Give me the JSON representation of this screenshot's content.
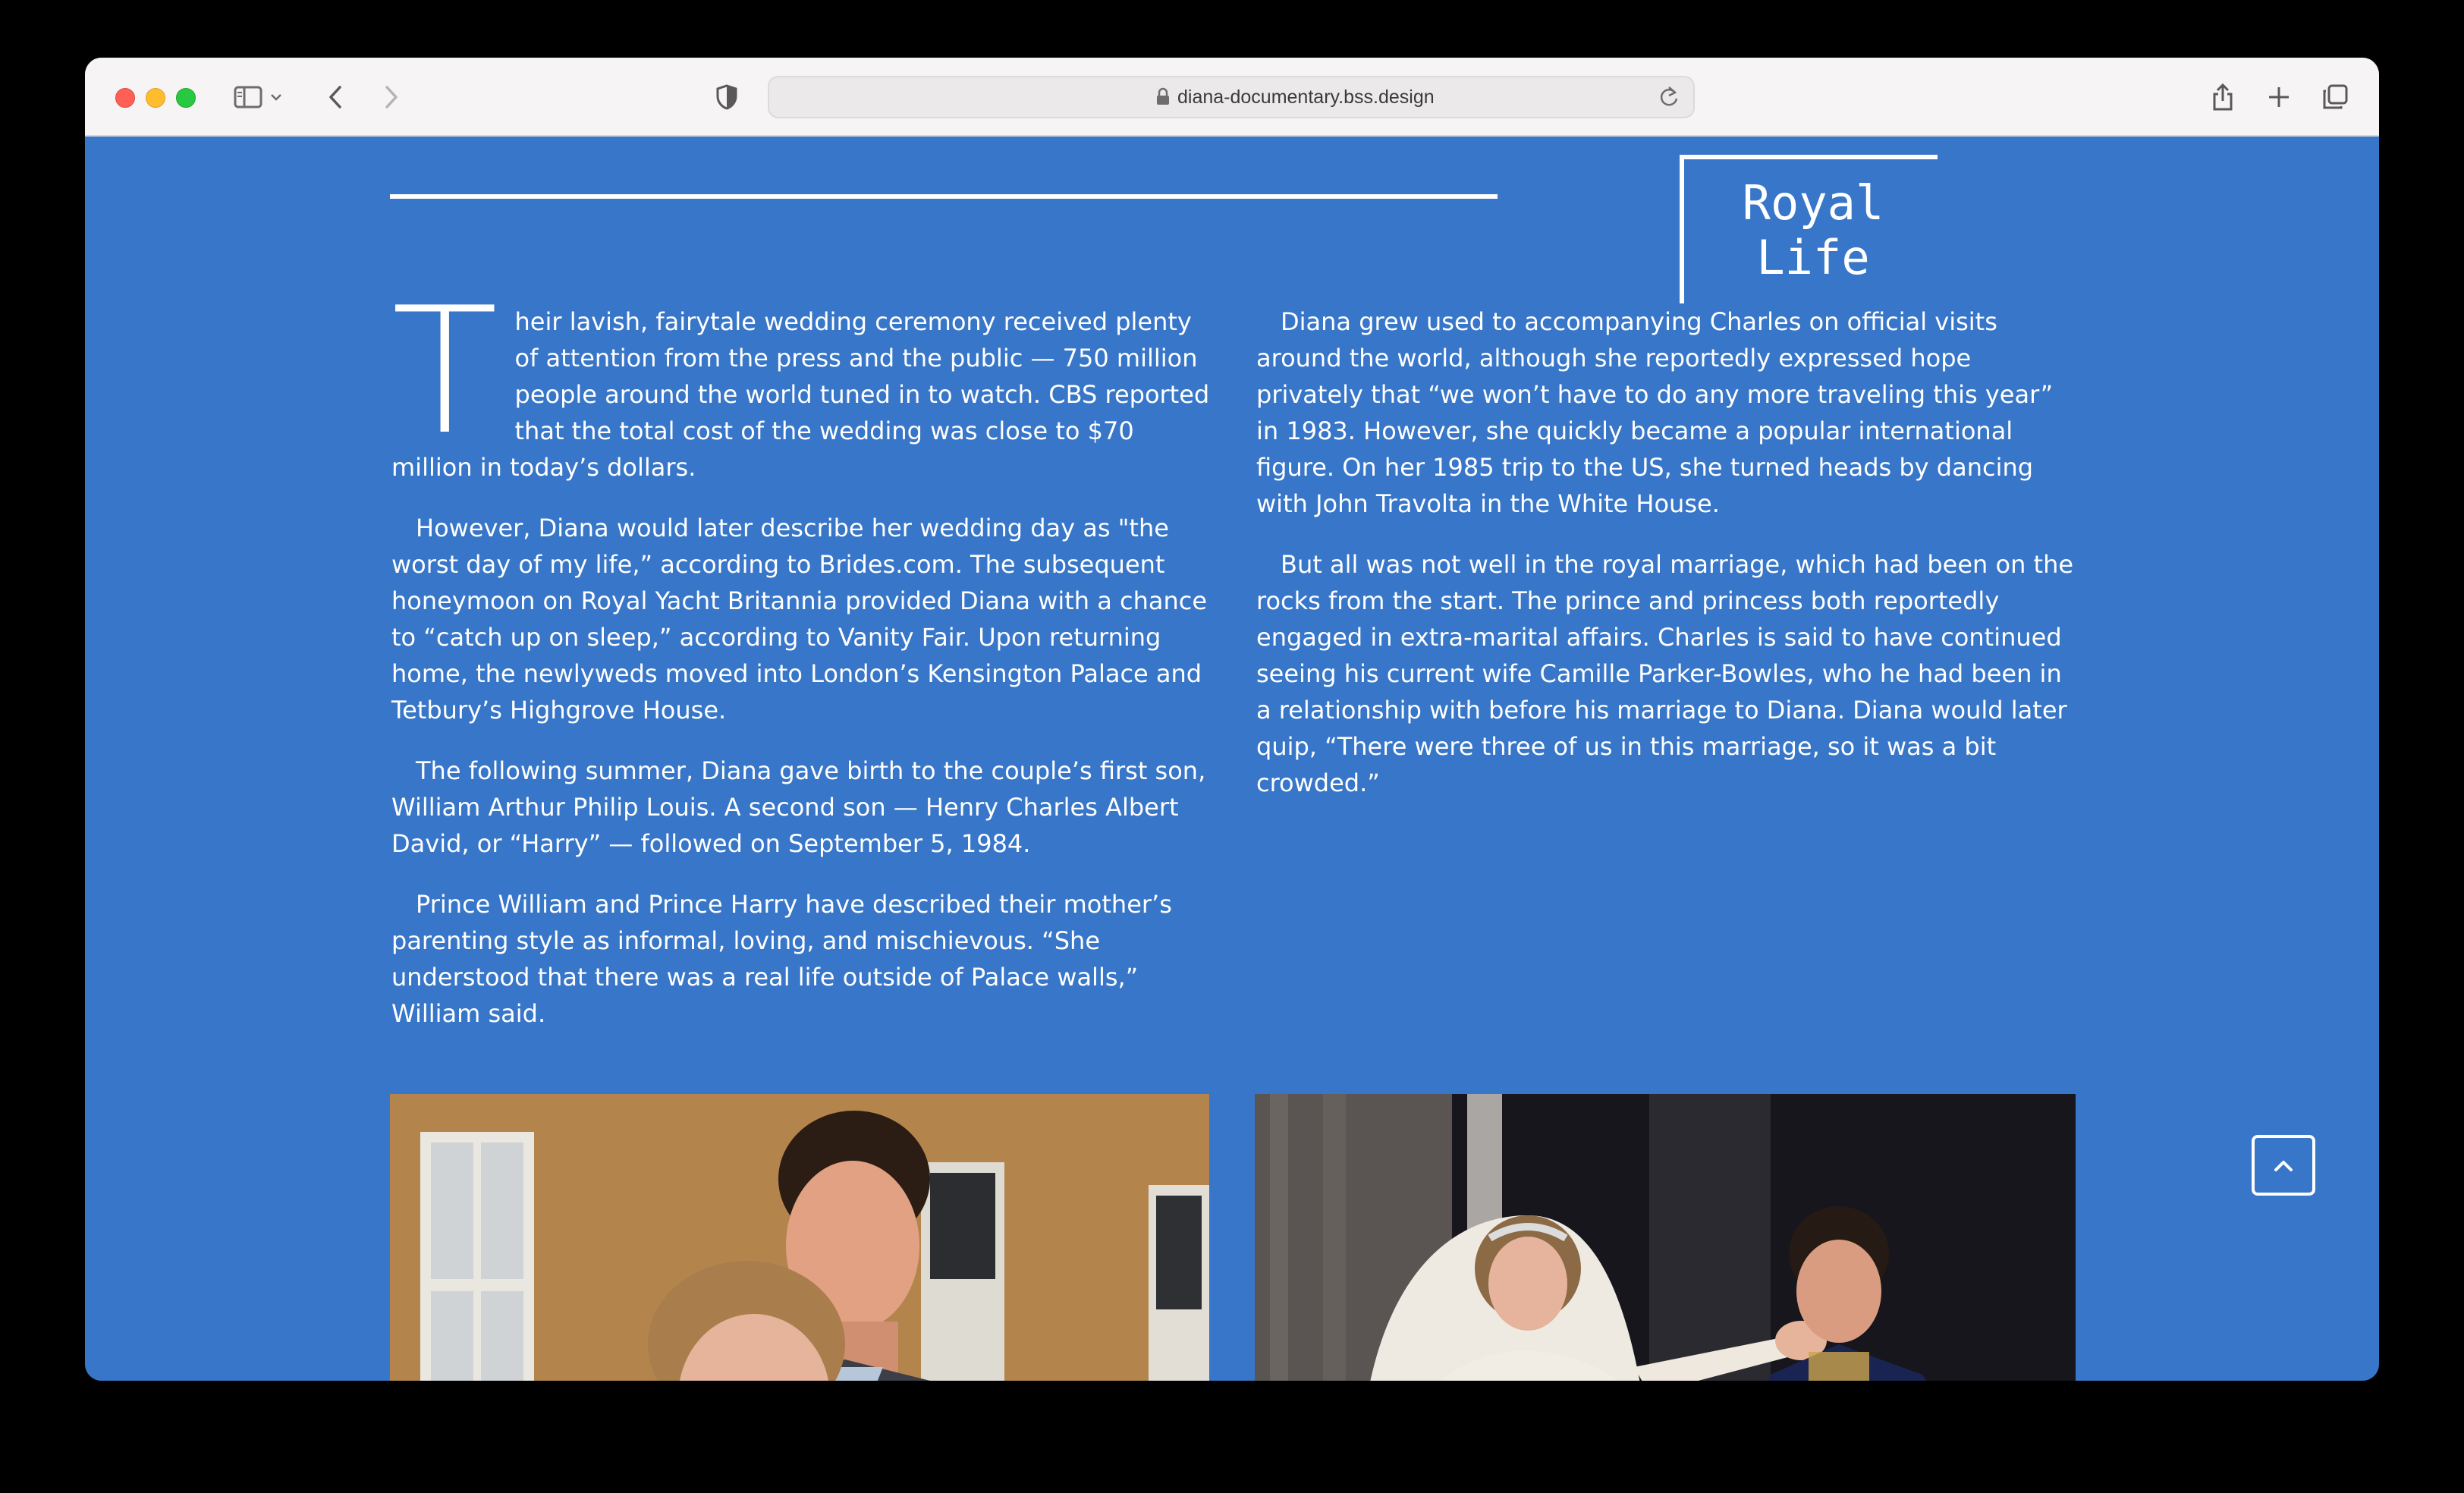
{
  "browser": {
    "url": "diana-documentary.bss.design",
    "icons": [
      "sidebar-icon",
      "chevron-down-icon",
      "back-icon",
      "forward-icon",
      "shield-icon",
      "lock-icon",
      "reload-icon",
      "share-icon",
      "plus-icon",
      "tabs-icon"
    ]
  },
  "section": {
    "title": "Royal Life"
  },
  "article": {
    "left": {
      "dropcap": "T",
      "p1": "heir lavish, fairytale wedding ceremony received plenty of attention from the press and the public — 750 million people around the world tuned in to watch. CBS reported that the total cost of the wedding was close to $70 million in today’s dollars.",
      "p2": "However, Diana would later describe her wedding day as \"the worst day of my life,” according to Brides.com. The subsequent honeymoon on Royal Yacht Britannia provided Diana with a chance to “catch up on sleep,” according to Vanity Fair. Upon returning home, the newlyweds moved into London’s Kensington Palace and Tetbury’s Highgrove House.",
      "p3": "The following summer, Diana gave birth to the couple’s first son, William Arthur Philip Louis. A second son — Henry Charles Albert David, or “Harry” — followed on September 5, 1984.",
      "p4": "Prince William and Prince Harry have described their mother’s parenting style as informal, loving, and mischievous. “She understood that there was a real life outside of Palace walls,” William said."
    },
    "right": {
      "p1": "Diana grew used to accompanying Charles on official visits around the world, although she reportedly expressed hope privately that “we won’t have to do any more traveling this year” in 1983. However, she quickly became a popular international figure. On her 1985 trip to the US, she turned heads by dancing with John Travolta in the White House.",
      "p2": "But all was not well in the royal marriage, which had been on the rocks from the start. The prince and princess both reportedly engaged in extra-marital affairs. Charles is said to have continued seeing his current wife Camille Parker-Bowles, who he had been in a relationship with before his marriage to Diana. Diana would later quip, “There were three of us in this marriage, so it was a bit crowded.”"
    }
  },
  "colors": {
    "page_background": "#3776c8",
    "text": "#ffffff",
    "window_chrome": "#f6f4f5"
  },
  "scroll_top": {
    "icon": "chevron-up-icon"
  }
}
